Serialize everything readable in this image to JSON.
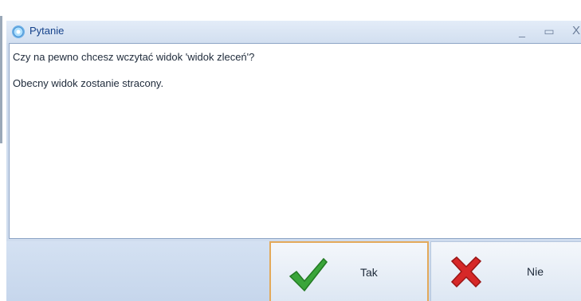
{
  "window": {
    "title": "Pytanie",
    "icon": "gear-icon",
    "controls": {
      "minimize": "_",
      "maximize": "▭",
      "close": "X"
    }
  },
  "message": {
    "line1": "Czy na pewno chcesz wczytać widok 'widok zleceń'?",
    "line2": "Obecny widok zostanie stracony."
  },
  "buttons": {
    "yes": {
      "label": "Tak",
      "icon": "checkmark-icon",
      "color": "#3aa53a"
    },
    "no": {
      "label": "Nie",
      "icon": "cross-icon",
      "color": "#d62828"
    }
  },
  "colors": {
    "titlebar": "#d6e2f2",
    "accent_border": "#e3a95a"
  }
}
